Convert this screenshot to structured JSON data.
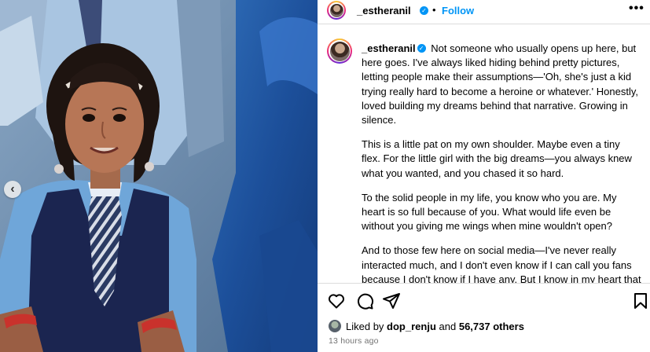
{
  "post": {
    "username": "_estheranil",
    "follow_label": "Follow",
    "separator": "•",
    "more_label": "•••",
    "caption": {
      "p1": "Not someone who usually opens up here, but here goes. I've always liked hiding behind pretty pictures, letting people make their assumptions—'Oh, she's just a kid trying really hard to become a heroine or whatever.' Honestly, loved building my dreams behind that narrative. Growing in silence.",
      "p2": "This is a little pat on my own shoulder. Maybe even a tiny flex. For the little girl with the big dreams—you always knew what you wanted, and you chased it so hard.",
      "p3": "To the solid people in my life, you know who you are. My heart is so full because of you. What would life even be without you giving me wings when mine wouldn't open?",
      "p4": "And to those few here on social media—I've never really interacted much, and I don't even know if I can call you fans because I don't know if I have any. But I know in my heart that some of you have genuinely loved me and wished me well. Thank you from the bottom of my heart. I hope I can give all that love back to you someday."
    },
    "likes": {
      "prefix": "Liked by ",
      "user": "dop_renju",
      "mid": " and ",
      "count": "56,737 others"
    },
    "timestamp": "13 hours ago"
  },
  "icons": {
    "verified": "verified-badge-icon",
    "prev": "chevron-left-icon",
    "like": "heart-icon",
    "comment": "comment-icon",
    "share": "send-icon",
    "save": "bookmark-icon"
  },
  "colors": {
    "accent": "#0095f6",
    "muted": "#737373",
    "divider": "#dbdbdb"
  }
}
